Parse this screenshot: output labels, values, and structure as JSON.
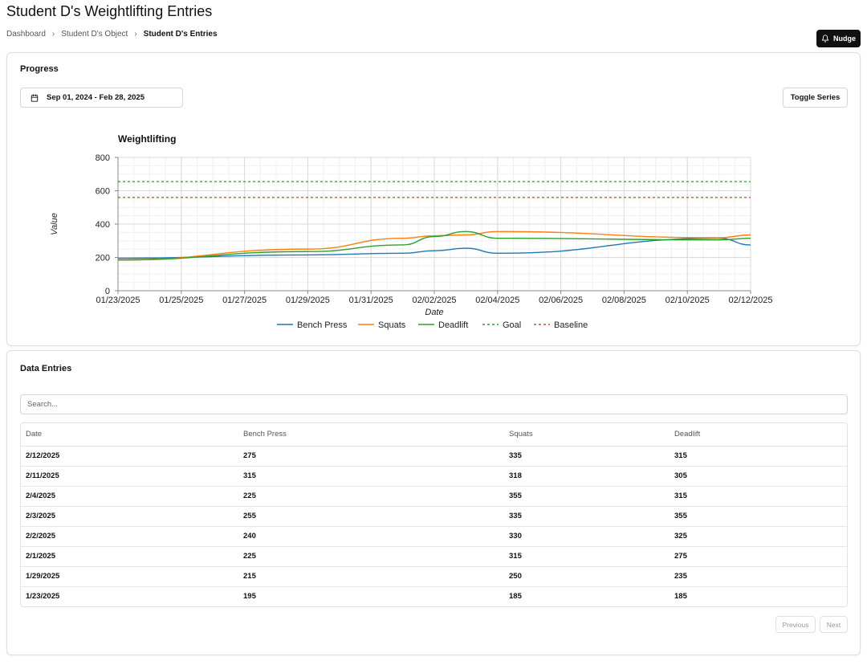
{
  "page": {
    "title": "Student D's Weightlifting Entries"
  },
  "breadcrumb": [
    {
      "label": "Dashboard"
    },
    {
      "label": "Student D's Object"
    },
    {
      "label": "Student D's Entries"
    }
  ],
  "nudge": {
    "label": "Nudge",
    "icon": "bell-icon"
  },
  "progress": {
    "title": "Progress",
    "date_range": "Sep 01, 2024 - Feb 28, 2025",
    "toggle_label": "Toggle Series"
  },
  "chart_data": {
    "type": "line",
    "title": "Weightlifting",
    "xlabel": "Date",
    "ylabel": "Value",
    "ylim": [
      0,
      800
    ],
    "yticks": [
      0,
      200,
      400,
      600,
      800
    ],
    "xlim": [
      "2025-01-23",
      "2025-02-12"
    ],
    "xticks": [
      "01/23/2025",
      "01/25/2025",
      "01/27/2025",
      "01/29/2025",
      "01/31/2025",
      "02/02/2025",
      "02/04/2025",
      "02/06/2025",
      "02/08/2025",
      "02/10/2025",
      "02/12/2025"
    ],
    "x": [
      "2025-01-23",
      "2025-01-29",
      "2025-02-01",
      "2025-02-02",
      "2025-02-03",
      "2025-02-04",
      "2025-02-11",
      "2025-02-12"
    ],
    "series": [
      {
        "name": "Bench Press",
        "color": "#1f77b4",
        "dashed": false,
        "values": [
          195,
          215,
          225,
          240,
          255,
          225,
          315,
          275
        ]
      },
      {
        "name": "Squats",
        "color": "#ff7f0e",
        "dashed": false,
        "values": [
          185,
          250,
          315,
          330,
          335,
          355,
          318,
          335
        ]
      },
      {
        "name": "Deadlift",
        "color": "#2ca02c",
        "dashed": false,
        "values": [
          185,
          235,
          275,
          325,
          355,
          315,
          305,
          315
        ]
      },
      {
        "name": "Goal",
        "color": "#2ca02c",
        "dashed": true,
        "constant": 655
      },
      {
        "name": "Baseline",
        "color": "#e8443a",
        "dashed": true,
        "constant": 560
      }
    ],
    "grid": true,
    "legend": "bottom"
  },
  "entries": {
    "title": "Data Entries",
    "search_placeholder": "Search...",
    "columns": [
      "Date",
      "Bench Press",
      "Squats",
      "Deadlift"
    ],
    "rows": [
      [
        "2/12/2025",
        "275",
        "335",
        "315"
      ],
      [
        "2/11/2025",
        "315",
        "318",
        "305"
      ],
      [
        "2/4/2025",
        "225",
        "355",
        "315"
      ],
      [
        "2/3/2025",
        "255",
        "335",
        "355"
      ],
      [
        "2/2/2025",
        "240",
        "330",
        "325"
      ],
      [
        "2/1/2025",
        "225",
        "315",
        "275"
      ],
      [
        "1/29/2025",
        "215",
        "250",
        "235"
      ],
      [
        "1/23/2025",
        "195",
        "185",
        "185"
      ]
    ],
    "previous_label": "Previous",
    "next_label": "Next"
  }
}
